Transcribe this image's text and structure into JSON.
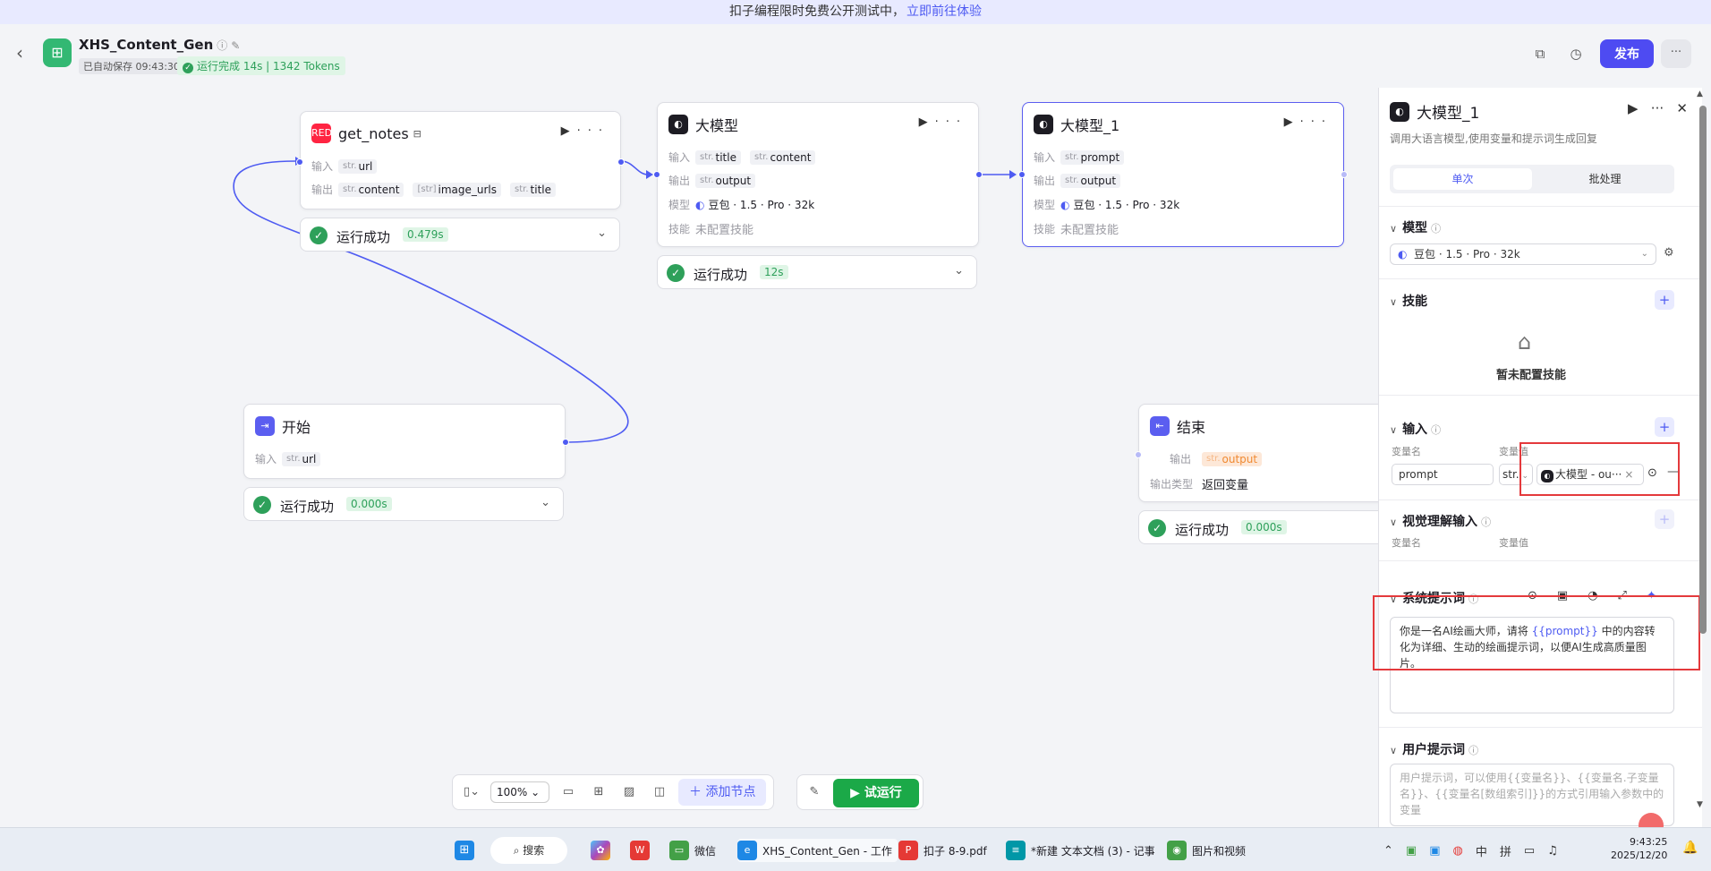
{
  "banner": {
    "text": "扣子编程限时免费公开测试中，",
    "link": "立即前往体验"
  },
  "header": {
    "app_name": "XHS_Content_Gen",
    "saved": "已自动保存 09:43:30",
    "run_status": "运行完成 14s | 1342 Tokens",
    "publish": "发布"
  },
  "nodes": {
    "get_notes": {
      "title": "get_notes",
      "input_label": "输入",
      "output_label": "输出",
      "inputs": [
        {
          "type": "str.",
          "name": "url"
        }
      ],
      "outputs": [
        {
          "type": "str.",
          "name": "content"
        },
        {
          "type": "[str]",
          "name": "image_urls"
        },
        {
          "type": "str.",
          "name": "title"
        }
      ],
      "run": {
        "text": "运行成功",
        "time": "0.479s"
      }
    },
    "llm": {
      "title": "大模型",
      "inputs": [
        {
          "type": "str.",
          "name": "title"
        },
        {
          "type": "str.",
          "name": "content"
        }
      ],
      "outputs": [
        {
          "type": "str.",
          "name": "output"
        }
      ],
      "model_label": "模型",
      "model": "豆包 · 1.5 · Pro · 32k",
      "skill_label": "技能",
      "skill": "未配置技能",
      "run": {
        "text": "运行成功",
        "time": "12s"
      }
    },
    "llm1": {
      "title": "大模型_1",
      "inputs": [
        {
          "type": "str.",
          "name": "prompt"
        }
      ],
      "outputs": [
        {
          "type": "str.",
          "name": "output"
        }
      ],
      "model_label": "模型",
      "model": "豆包 · 1.5 · Pro · 32k",
      "skill_label": "技能",
      "skill": "未配置技能"
    },
    "start": {
      "title": "开始",
      "inputs": [
        {
          "type": "str.",
          "name": "url"
        }
      ],
      "run": {
        "text": "运行成功",
        "time": "0.000s"
      }
    },
    "end": {
      "title": "结束",
      "output_label": "输出",
      "output": {
        "type": "str.",
        "name": "output"
      },
      "output_type_label": "输出类型",
      "output_type": "返回变量",
      "run": {
        "text": "运行成功",
        "time": "0.000s"
      }
    }
  },
  "toolbar": {
    "zoom": "100%",
    "add_node": "添加节点",
    "test_run": "试运行"
  },
  "panel": {
    "title": "大模型_1",
    "desc": "调用大语言模型,使用变量和提示词生成回复",
    "tabs": [
      "单次",
      "批处理"
    ],
    "model_section": "模型",
    "model_value": "豆包 · 1.5 · Pro · 32k",
    "skills_section": "技能",
    "skills_empty": "暂未配置技能",
    "input_section": "输入",
    "col_name": "变量名",
    "col_value": "变量值",
    "input_name": "prompt",
    "input_type": "str.",
    "input_ref": "大模型 - ou···",
    "vision_section": "视觉理解输入",
    "sys_prompt_section": "系统提示词",
    "sys_prompt_before": "你是一名AI绘画大师，请将 ",
    "sys_prompt_var": "{{prompt}}",
    "sys_prompt_after": " 中的内容转化为详细、生动的绘画提示词，以便AI生成高质量图片。",
    "user_prompt_section": "用户提示词",
    "user_prompt_placeholder": "用户提示词，可以使用{{变量名}}、{{变量名.子变量名}}、{{变量名[数组索引]}}的方式引用输入参数中的变量"
  },
  "taskbar": {
    "search": "搜索",
    "items": [
      "微信",
      "XHS_Content_Gen - 工作",
      "扣子 8-9.pdf",
      "*新建 文本文档 (3) - 记事",
      "图片和视频"
    ],
    "ime_1": "中",
    "ime_2": "拼",
    "time": "9:43:25",
    "date": "2025/12/20"
  },
  "colors": {
    "accent": "#4e5bf2",
    "success": "#2ea05a",
    "publish": "#4e4bf2",
    "test_run": "#1ba948"
  }
}
